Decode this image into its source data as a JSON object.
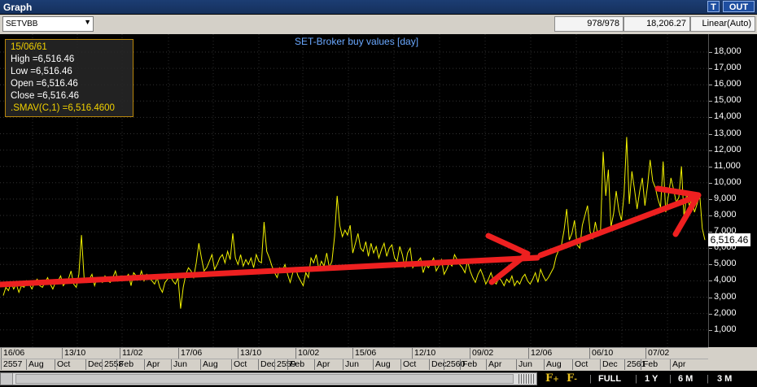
{
  "window": {
    "title": "Graph",
    "t_button": "T",
    "out_button": "OUT"
  },
  "toolbar": {
    "symbol": "SETVBB",
    "count": "978/978",
    "value": "18,206.27",
    "scale": "Linear(Auto)"
  },
  "chart_title": "SET-Broker buy values [day]",
  "info": {
    "date": "15/06/61",
    "high": "High  =6,516.46",
    "low": "Low   =6,516.46",
    "open": "Open  =6,516.46",
    "close": "Close  =6,516.46",
    "smav": ".SMAV(C,1)  =6,516.4600"
  },
  "last_price": "6,516.46",
  "y_ticks": [
    "18,000",
    "17,000",
    "16,000",
    "15,000",
    "14,000",
    "13,000",
    "12,000",
    "11,000",
    "10,000",
    "9,000",
    "8,000",
    "7,000",
    "6,000",
    "5,000",
    "4,000",
    "3,000",
    "2,000",
    "1,000"
  ],
  "x_labels_top": [
    "16/06",
    "13/10",
    "11/02",
    "17/06",
    "13/10",
    "10/02",
    "15/06",
    "12/10",
    "09/02",
    "12/06",
    "06/10",
    "07/02"
  ],
  "x_labels_bottom": [
    "2557",
    "Aug",
    "Oct",
    "Dec",
    "2558",
    "Feb",
    "Apr",
    "Jun",
    "Aug",
    "Oct",
    "Dec",
    "2559",
    "Feb",
    "Apr",
    "Jun",
    "Aug",
    "Oct",
    "Dec",
    "2560",
    "Feb",
    "Apr",
    "Jun",
    "Aug",
    "Oct",
    "Dec",
    "2561",
    "Feb",
    "Apr"
  ],
  "colors": {
    "series": "#f2f200",
    "annotation": "#ee2020",
    "title": "#6aa8ff"
  },
  "chart_data": {
    "type": "line",
    "title": "SET-Broker buy values [day]",
    "ylim": [
      0,
      18500
    ],
    "series": [
      {
        "values": [
          3100,
          3600,
          3400,
          3900,
          3500,
          3800,
          3300,
          3700,
          3600,
          4000,
          3800,
          3500,
          3900,
          4100,
          3700,
          3600,
          3900,
          4200,
          3800,
          3500,
          3900,
          4000,
          4300,
          3700,
          3900,
          4100,
          4600,
          3800,
          3600,
          4400,
          6800,
          4200,
          3900,
          4100,
          4400,
          3700,
          4200,
          4100,
          3900,
          4300,
          4000,
          3900,
          4200,
          4600,
          4000,
          4300,
          4100,
          4200,
          4400,
          3700,
          4500,
          4300,
          4100,
          4600,
          4000,
          4400,
          4200,
          4000,
          3800,
          4200,
          3600,
          3300,
          3900,
          4100,
          4300,
          4000,
          3800,
          4200,
          2300,
          3600,
          4400,
          4800,
          4600,
          4200,
          5100,
          6300,
          5400,
          4600,
          4800,
          5200,
          5600,
          4700,
          5000,
          5400,
          5600,
          5100,
          5800,
          5300,
          6900,
          5400,
          5000,
          5600,
          4900,
          5300,
          5000,
          5400,
          4800,
          5600,
          5200,
          5100,
          7600,
          5800,
          5400,
          4900,
          4500,
          4200,
          4800,
          4600,
          5000,
          4400,
          3900,
          4500,
          4800,
          4300,
          4000,
          3700,
          4500,
          4200,
          5400,
          5100,
          5600,
          4700,
          5200,
          4900,
          5700,
          4800,
          5200,
          6700,
          9200,
          7400,
          6700,
          7100,
          6800,
          7400,
          5700,
          6300,
          6900,
          6000,
          5800,
          6400,
          5500,
          6300,
          5700,
          6100,
          5400,
          5900,
          6300,
          5500,
          6000,
          6200,
          5400,
          5200,
          6100,
          5600,
          4800,
          5700,
          6000,
          4800,
          5100,
          5200,
          5400,
          4500,
          5000,
          4800,
          5100,
          5400,
          4600,
          4900,
          5300,
          4400,
          4700,
          5100,
          4900,
          5600,
          5300,
          5000,
          4800,
          4500,
          5200,
          4600,
          4200,
          3900,
          4400,
          4700,
          4300,
          3800,
          4100,
          4500,
          4000,
          3800,
          4200,
          4000,
          3700,
          4100,
          3900,
          4300,
          3700,
          4000,
          3800,
          4200,
          4400,
          4000,
          3800,
          4100,
          4500,
          3900,
          4700,
          4300,
          4000,
          4200,
          4500,
          4800,
          5500,
          5900,
          6200,
          7100,
          8400,
          6500,
          6900,
          7700,
          6200,
          6000,
          7400,
          8000,
          8600,
          7000,
          6600,
          7600,
          6800,
          7100,
          11900,
          9200,
          10800,
          7300,
          8100,
          9500,
          8300,
          7700,
          9300,
          12800,
          8700,
          10700,
          9600,
          8400,
          9500,
          10300,
          8600,
          9800,
          11400,
          10100,
          9700,
          9000,
          8500,
          11300,
          8200,
          9200,
          10300,
          9600,
          8800,
          9100,
          11000,
          7800,
          9400,
          8600,
          9000,
          8200,
          8700,
          9300,
          7200,
          6500
        ]
      }
    ]
  }
}
